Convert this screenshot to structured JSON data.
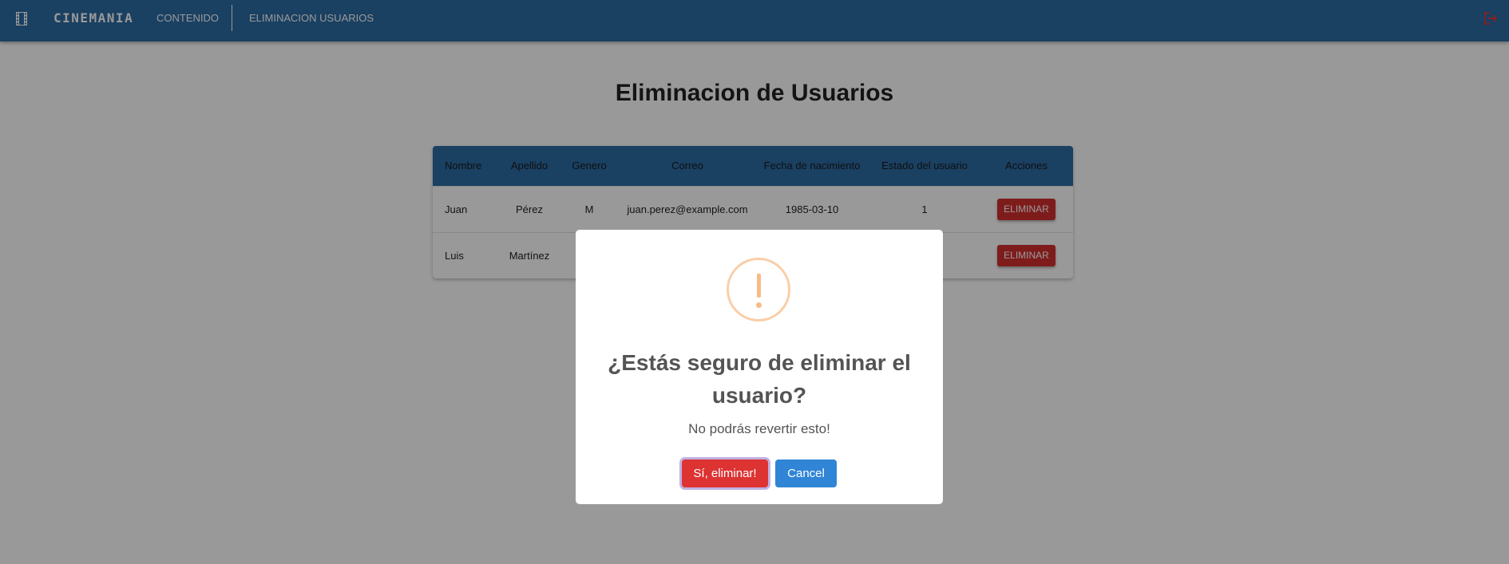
{
  "appbar": {
    "brand": "CINEMANIA",
    "nav": [
      {
        "label": "CONTENIDO"
      },
      {
        "label": "ELIMINACION USUARIOS"
      }
    ],
    "icons": {
      "menu": "film-icon",
      "logout": "logout-icon"
    },
    "colors": {
      "background": "#2c6ca3",
      "logout": "#e53935"
    }
  },
  "page": {
    "title": "Eliminacion de Usuarios"
  },
  "table": {
    "columns": [
      "Nombre",
      "Apellido",
      "Genero",
      "Correo",
      "Fecha de nacimiento",
      "Estado del usuario",
      "Acciones"
    ],
    "rows": [
      {
        "nombre": "Juan",
        "apellido": "Pérez",
        "genero": "M",
        "correo": "juan.perez@example.com",
        "fecha": "1985-03-10",
        "estado": "1",
        "accion": "ELIMINAR"
      },
      {
        "nombre": "Luis",
        "apellido": "Martínez",
        "genero": "",
        "correo": "",
        "fecha": "",
        "estado": "",
        "accion": "ELIMINAR"
      }
    ],
    "colors": {
      "header": "#2c6ca3",
      "delete_button": "#d32f2f"
    }
  },
  "dialog": {
    "icon": "warning-icon",
    "title": "¿Estás seguro de eliminar el usuario?",
    "text": "No podrás revertir esto!",
    "confirm_label": "Sí, eliminar!",
    "cancel_label": "Cancel",
    "colors": {
      "confirm": "#dd3333",
      "cancel": "#3085d6",
      "icon": "#f8bb86"
    }
  }
}
